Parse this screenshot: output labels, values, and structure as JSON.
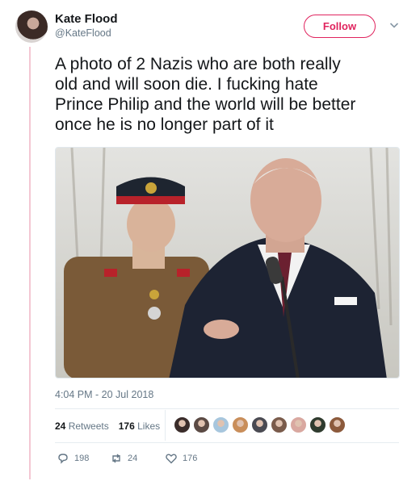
{
  "author": {
    "name": "Kate Flood",
    "handle": "@KateFlood"
  },
  "follow_label": "Follow",
  "tweet": {
    "lines": [
      "A photo of 2 Nazis who are both really",
      "old and will soon die. I fucking hate",
      "Prince Philip and the world will be better",
      "once he is no longer part of it"
    ],
    "timestamp": "4:04 PM - 20 Jul 2018"
  },
  "stats": {
    "retweets_count": "24",
    "retweets_label": "Retweets",
    "likes_count": "176",
    "likes_label": "Likes"
  },
  "actions": {
    "replies": "198",
    "retweets": "24",
    "likes": "176"
  },
  "colors": {
    "accent": "#e0245e",
    "muted": "#657786",
    "thread_line": "#f4c7d3"
  },
  "liker_avatars": [
    "#3a2c2a",
    "#5b4a44",
    "#a7c6dd",
    "#c98e5a",
    "#4a4a52",
    "#7a5b4b",
    "#d9a8a0",
    "#2f3b2e",
    "#8c5a3c"
  ]
}
